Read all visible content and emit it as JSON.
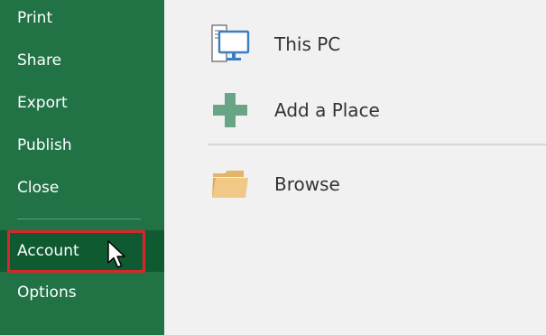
{
  "sidebar": {
    "items": [
      {
        "id": "print",
        "label": "Print"
      },
      {
        "id": "share",
        "label": "Share"
      },
      {
        "id": "export",
        "label": "Export"
      },
      {
        "id": "publish",
        "label": "Publish"
      },
      {
        "id": "close",
        "label": "Close"
      },
      {
        "id": "account",
        "label": "Account",
        "active": true
      },
      {
        "id": "options",
        "label": "Options"
      }
    ]
  },
  "places": [
    {
      "id": "this-pc",
      "label": "This PC",
      "icon": "computer-icon"
    },
    {
      "id": "add-place",
      "label": "Add a Place",
      "icon": "plus-icon"
    },
    {
      "id": "browse",
      "label": "Browse",
      "icon": "folder-icon"
    }
  ],
  "colors": {
    "sidebar_bg": "#217346",
    "sidebar_active": "#0f5a31",
    "highlight": "#d8262d",
    "main_bg": "#f1f1f1"
  }
}
